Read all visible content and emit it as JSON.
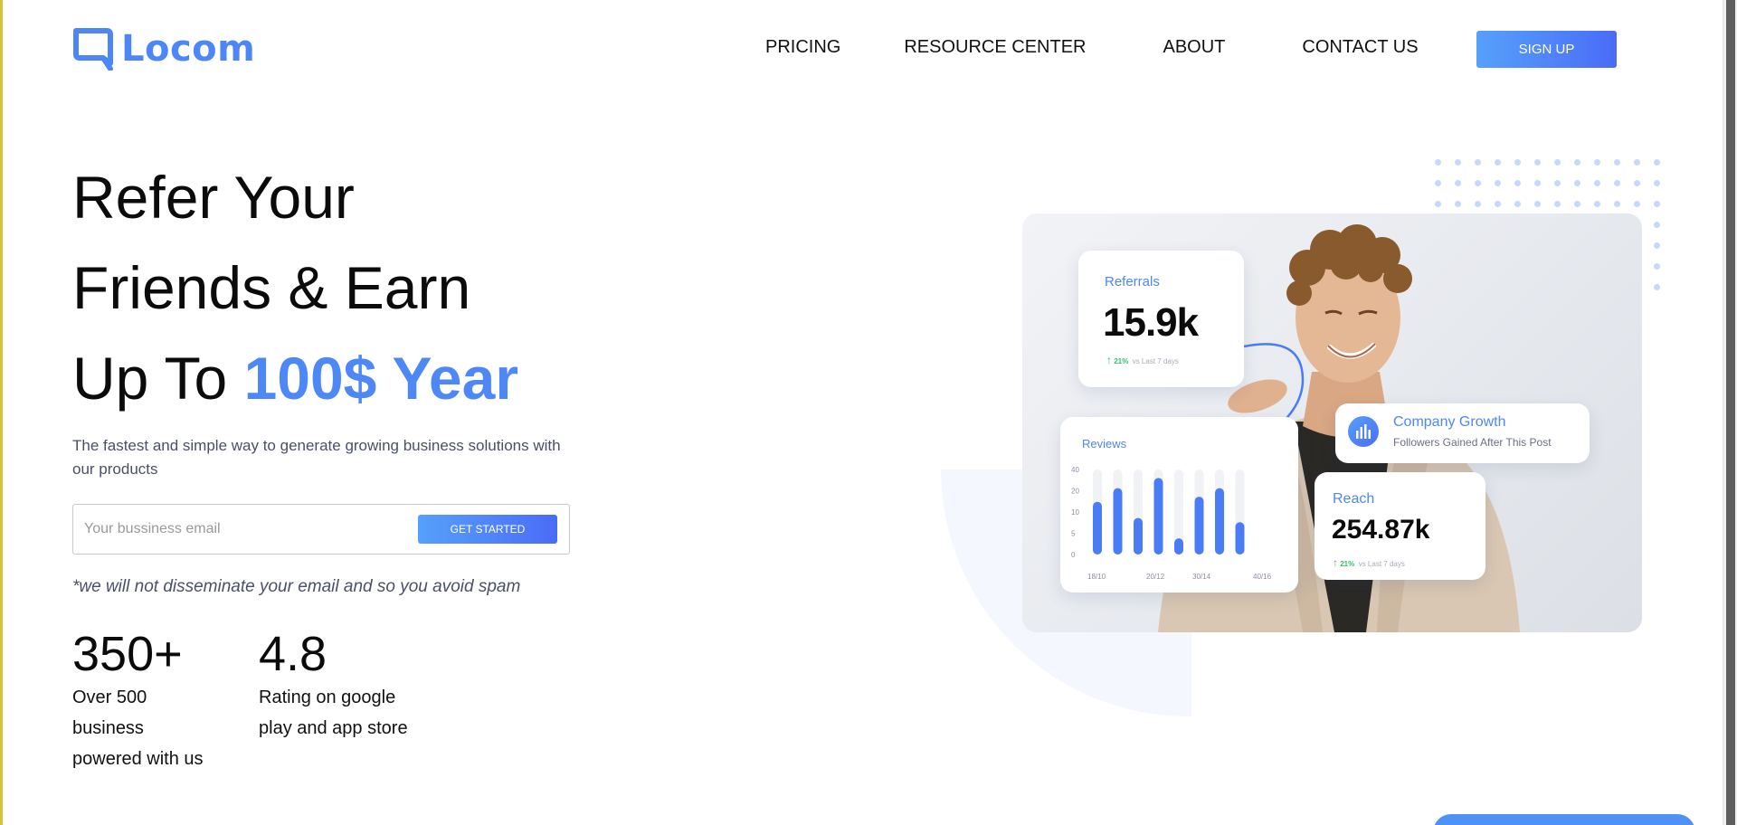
{
  "header": {
    "logo_text": "Locom",
    "nav": [
      "PRICING",
      "RESOURCE CENTER",
      "ABOUT",
      "CONTACT US"
    ],
    "signup_label": "SIGN UP"
  },
  "hero": {
    "title_line1": "Refer Your",
    "title_line2": "Friends & Earn",
    "title_line3_prefix": "Up To ",
    "title_line3_accent": "100$ Year",
    "subtitle": "The fastest and simple way to generate growing business solutions with our products",
    "email_placeholder": "Your bussiness email",
    "cta_label": "GET STARTED",
    "note": "*we will not disseminate your email and so you avoid spam"
  },
  "stats": [
    {
      "value": "350+",
      "desc": "Over 500 business powered with us"
    },
    {
      "value": "4.8",
      "desc": "Rating on google play and app store"
    }
  ],
  "cards": {
    "referrals": {
      "label": "Referrals",
      "value": "15.9k",
      "change": "21%",
      "period": "vs Last 7 days"
    },
    "reviews": {
      "label": "Reviews"
    },
    "growth": {
      "title": "Company Growth",
      "subtitle": "Followers Gained After This Post"
    },
    "reach": {
      "label": "Reach",
      "value": "254.87k",
      "change": "21%",
      "period": "vs Last 7 days"
    }
  },
  "chart_data": {
    "type": "bar",
    "title": "Reviews",
    "yticks": [
      "40",
      "20",
      "10",
      "5",
      "0"
    ],
    "xticks": [
      "18/10",
      "20/12",
      "30/14",
      "40/16"
    ],
    "values": [
      0.62,
      0.78,
      0.43,
      0.9,
      0.19,
      0.68,
      0.78,
      0.38
    ],
    "colors": {
      "bar": "#4a7cf6",
      "track": "#f1f2f5"
    }
  },
  "colors": {
    "accent": "#4e88f7",
    "button_gradient_start": "#56a0fb",
    "button_gradient_end": "#4a6cf6"
  }
}
